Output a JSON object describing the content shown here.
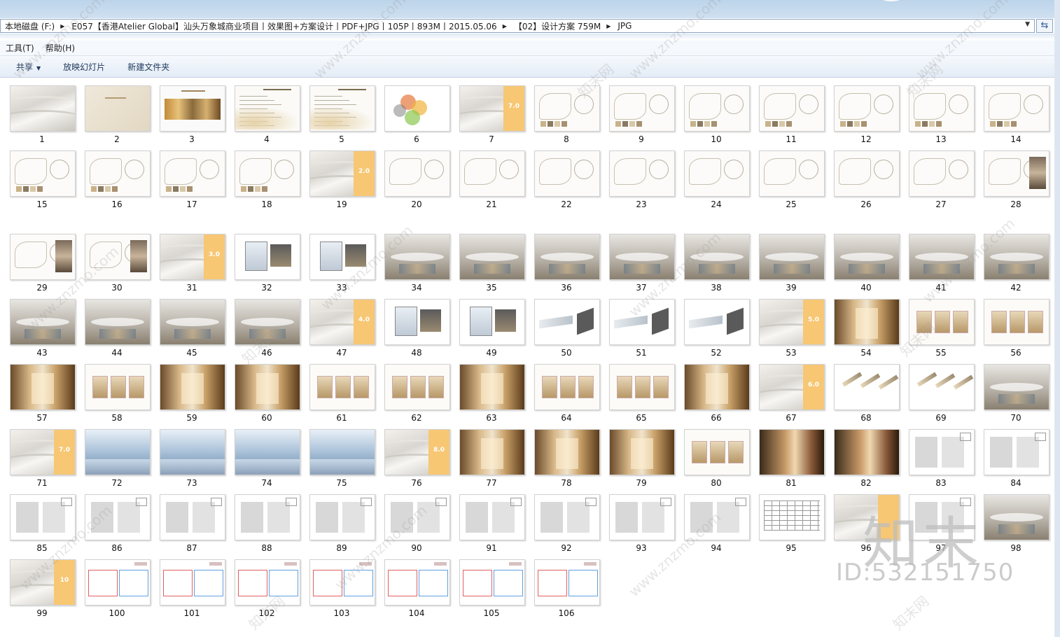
{
  "address": {
    "segments": [
      "本地磁盘 (F:)",
      "E057【香港Atelier Global】汕头万象城商业项目丨效果图+方案设计丨PDF+JPG丨105P丨893M丨2015.05.06",
      "【02】设计方案 759M",
      "JPG"
    ],
    "dropdown_icon": "chevron-down-icon",
    "refresh_icon": "refresh-icon"
  },
  "menu": {
    "items": [
      "工具(T)",
      "帮助(H)"
    ]
  },
  "toolbar": {
    "share": "共享",
    "slideshow": "放映幻灯片",
    "new_folder": "新建文件夹"
  },
  "files": [
    "1",
    "2",
    "3",
    "4",
    "5",
    "6",
    "7",
    "8",
    "9",
    "10",
    "11",
    "12",
    "13",
    "14",
    "15",
    "16",
    "17",
    "18",
    "19",
    "20",
    "21",
    "22",
    "23",
    "24",
    "25",
    "26",
    "27",
    "28",
    "29",
    "30",
    "31",
    "32",
    "33",
    "34",
    "35",
    "36",
    "37",
    "38",
    "39",
    "40",
    "41",
    "42",
    "43",
    "44",
    "45",
    "46",
    "47",
    "48",
    "49",
    "50",
    "51",
    "52",
    "53",
    "54",
    "55",
    "56",
    "57",
    "58",
    "59",
    "60",
    "61",
    "62",
    "63",
    "64",
    "65",
    "66",
    "67",
    "68",
    "69",
    "70",
    "71",
    "72",
    "73",
    "74",
    "75",
    "76",
    "77",
    "78",
    "79",
    "80",
    "81",
    "82",
    "83",
    "84",
    "85",
    "86",
    "87",
    "88",
    "89",
    "90",
    "91",
    "92",
    "93",
    "94",
    "95",
    "96",
    "97",
    "98",
    "99",
    "100",
    "101",
    "102",
    "103",
    "104",
    "105",
    "106"
  ],
  "thumbnails": {
    "1": {
      "kind": "wave"
    },
    "2": {
      "kind": "beige"
    },
    "3": {
      "kind": "mood"
    },
    "4": {
      "kind": "doc"
    },
    "5": {
      "kind": "doc"
    },
    "6": {
      "kind": "circles"
    },
    "7": {
      "kind": "section",
      "label": "7.0"
    },
    "8": {
      "kind": "plan"
    },
    "9": {
      "kind": "plan"
    },
    "10": {
      "kind": "plan"
    },
    "11": {
      "kind": "plan"
    },
    "12": {
      "kind": "plan"
    },
    "13": {
      "kind": "plan"
    },
    "14": {
      "kind": "plan"
    },
    "15": {
      "kind": "plan"
    },
    "16": {
      "kind": "plan"
    },
    "17": {
      "kind": "plan"
    },
    "18": {
      "kind": "plan"
    },
    "19": {
      "kind": "section",
      "label": "2.0"
    },
    "20": {
      "kind": "sketch"
    },
    "21": {
      "kind": "sketch"
    },
    "22": {
      "kind": "sketch"
    },
    "23": {
      "kind": "sketch"
    },
    "24": {
      "kind": "sketch"
    },
    "25": {
      "kind": "sketch"
    },
    "26": {
      "kind": "sketch"
    },
    "27": {
      "kind": "sketch"
    },
    "28": {
      "kind": "sketch-photo"
    },
    "29": {
      "kind": "sketch-photo"
    },
    "30": {
      "kind": "sketch-photo"
    },
    "31": {
      "kind": "section",
      "label": "3.0"
    },
    "32": {
      "kind": "model"
    },
    "33": {
      "kind": "model"
    },
    "34": {
      "kind": "render"
    },
    "35": {
      "kind": "render"
    },
    "36": {
      "kind": "render"
    },
    "37": {
      "kind": "render"
    },
    "38": {
      "kind": "render"
    },
    "39": {
      "kind": "render"
    },
    "40": {
      "kind": "render"
    },
    "41": {
      "kind": "render"
    },
    "42": {
      "kind": "render"
    },
    "43": {
      "kind": "render"
    },
    "44": {
      "kind": "render"
    },
    "45": {
      "kind": "render"
    },
    "46": {
      "kind": "render"
    },
    "47": {
      "kind": "section",
      "label": "4.0"
    },
    "48": {
      "kind": "model"
    },
    "49": {
      "kind": "model"
    },
    "50": {
      "kind": "rail"
    },
    "51": {
      "kind": "rail"
    },
    "52": {
      "kind": "rail"
    },
    "53": {
      "kind": "section",
      "label": "5.0"
    },
    "54": {
      "kind": "interior"
    },
    "55": {
      "kind": "panel"
    },
    "56": {
      "kind": "panel"
    },
    "57": {
      "kind": "interior"
    },
    "58": {
      "kind": "panel"
    },
    "59": {
      "kind": "interior"
    },
    "60": {
      "kind": "interior"
    },
    "61": {
      "kind": "ceiling"
    },
    "62": {
      "kind": "panel"
    },
    "63": {
      "kind": "interior"
    },
    "64": {
      "kind": "ceiling"
    },
    "65": {
      "kind": "panel"
    },
    "66": {
      "kind": "interior"
    },
    "67": {
      "kind": "section",
      "label": "6.0"
    },
    "68": {
      "kind": "lamp"
    },
    "69": {
      "kind": "lamp"
    },
    "70": {
      "kind": "render"
    },
    "71": {
      "kind": "section",
      "label": "7.0"
    },
    "72": {
      "kind": "blue"
    },
    "73": {
      "kind": "blue"
    },
    "74": {
      "kind": "blue"
    },
    "75": {
      "kind": "blue"
    },
    "76": {
      "kind": "section",
      "label": "8.0"
    },
    "77": {
      "kind": "interior"
    },
    "78": {
      "kind": "interior"
    },
    "79": {
      "kind": "interior"
    },
    "80": {
      "kind": "panel"
    },
    "81": {
      "kind": "dark"
    },
    "82": {
      "kind": "dark"
    },
    "83": {
      "kind": "floor"
    },
    "84": {
      "kind": "floor"
    },
    "85": {
      "kind": "floor"
    },
    "86": {
      "kind": "floor"
    },
    "87": {
      "kind": "floor"
    },
    "88": {
      "kind": "floor"
    },
    "89": {
      "kind": "floor"
    },
    "90": {
      "kind": "floor"
    },
    "91": {
      "kind": "floor"
    },
    "92": {
      "kind": "floor"
    },
    "93": {
      "kind": "floor"
    },
    "94": {
      "kind": "floor"
    },
    "95": {
      "kind": "table"
    },
    "96": {
      "kind": "section",
      "label": ""
    },
    "97": {
      "kind": "floor"
    },
    "98": {
      "kind": "render"
    },
    "99": {
      "kind": "section",
      "label": "10"
    },
    "100": {
      "kind": "redplan"
    },
    "101": {
      "kind": "redplan"
    },
    "102": {
      "kind": "redplan"
    },
    "103": {
      "kind": "redplan"
    },
    "104": {
      "kind": "redplan"
    },
    "105": {
      "kind": "redplan"
    },
    "106": {
      "kind": "redplan"
    }
  },
  "watermark": {
    "text": "www.znzmo.com",
    "brand": "知末网",
    "logo": "知末",
    "id": "ID:532151750"
  },
  "colors": {
    "accent_orange": "#f7c774",
    "selection_blue": "#cde3f7"
  }
}
